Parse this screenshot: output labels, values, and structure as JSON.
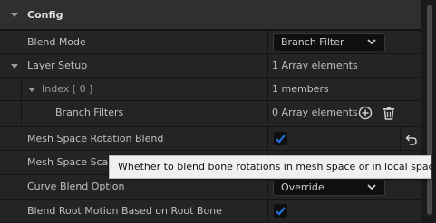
{
  "section": {
    "title": "Config"
  },
  "rows": {
    "blend_mode": {
      "label": "Blend Mode",
      "value": "Branch Filter"
    },
    "layer_setup": {
      "label": "Layer Setup",
      "value": "1 Array elements"
    },
    "index": {
      "label": "Index [ 0 ]",
      "value": "1 members"
    },
    "branch_filters": {
      "label": "Branch Filters",
      "value": "0 Array elements"
    },
    "mesh_space_rotation_blend": {
      "label": "Mesh Space Rotation Blend",
      "checked": true
    },
    "mesh_space_scale_blend": {
      "label": "Mesh Space Scale Blend"
    },
    "curve_blend_option": {
      "label": "Curve Blend Option",
      "value": "Override"
    },
    "blend_root_motion": {
      "label": "Blend Root Motion Based on Root Bone",
      "checked": true
    }
  },
  "tooltip": {
    "text": "Whether to blend bone rotations in mesh space or in local space"
  },
  "icons": {
    "expand": "triangle-down",
    "add": "plus-circle-icon",
    "delete": "trash-icon",
    "reset": "reset-arrow-icon",
    "dropdown": "chevron-down-icon",
    "checkbox": "checkmark-icon"
  },
  "colors": {
    "accent": "#1f6fd1",
    "panel": "#242424",
    "header": "#2f2f2f"
  }
}
